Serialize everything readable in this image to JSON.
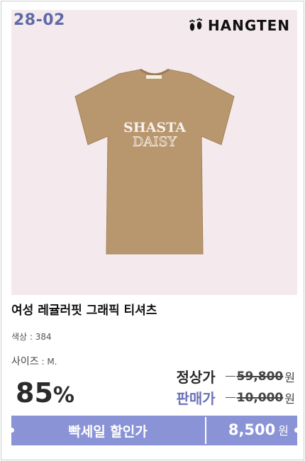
{
  "hero": {
    "code": "28-02",
    "brand": "HANGTEN",
    "shirt_print_top": "SHASTA",
    "shirt_print_bottom": "DAISY",
    "shirt_color": "#b8966e"
  },
  "product": {
    "title": "여성 레귤러핏 그래픽 티셔츠",
    "color_label": "색상",
    "color_value": ": 384",
    "size_label": "사이즈",
    "size_value": ": M."
  },
  "pricing": {
    "discount_number": "85",
    "discount_symbol": "%",
    "regular_label": "정상가",
    "regular_price": "59,800",
    "sale_label": "판매가",
    "sale_price": "10,000",
    "won": "원"
  },
  "promo": {
    "label": "빡세일 할인가",
    "price": "8,500",
    "won": "원",
    "bar_color": "#8a93d6",
    "accent": "#5e6aa8"
  }
}
